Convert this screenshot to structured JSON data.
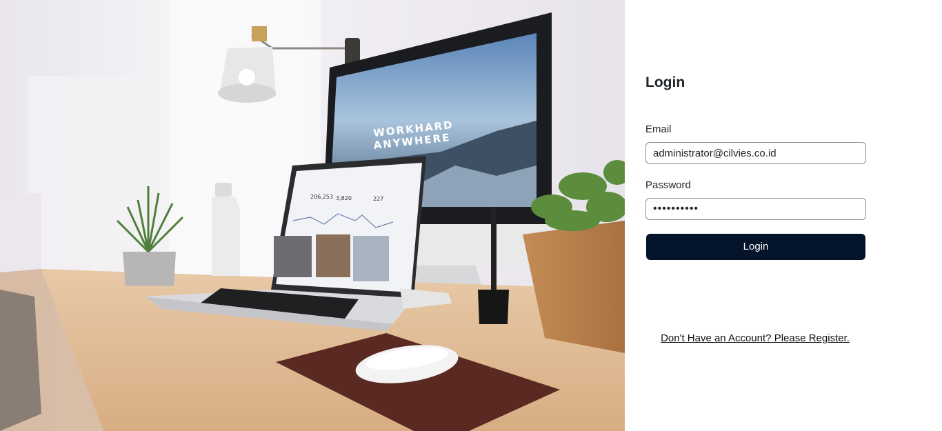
{
  "hero": {
    "monitor_text_line1": "WORKHARD",
    "monitor_text_line2": "ANYWHERE",
    "laptop_stats": [
      "206,253",
      "3,820",
      "227"
    ]
  },
  "login": {
    "title": "Login",
    "email_label": "Email",
    "email_value": "administrator@cilvies.co.id",
    "password_label": "Password",
    "password_value": "••••••••••",
    "submit_label": "Login",
    "register_link": "Don't Have an Account? Please Register."
  }
}
